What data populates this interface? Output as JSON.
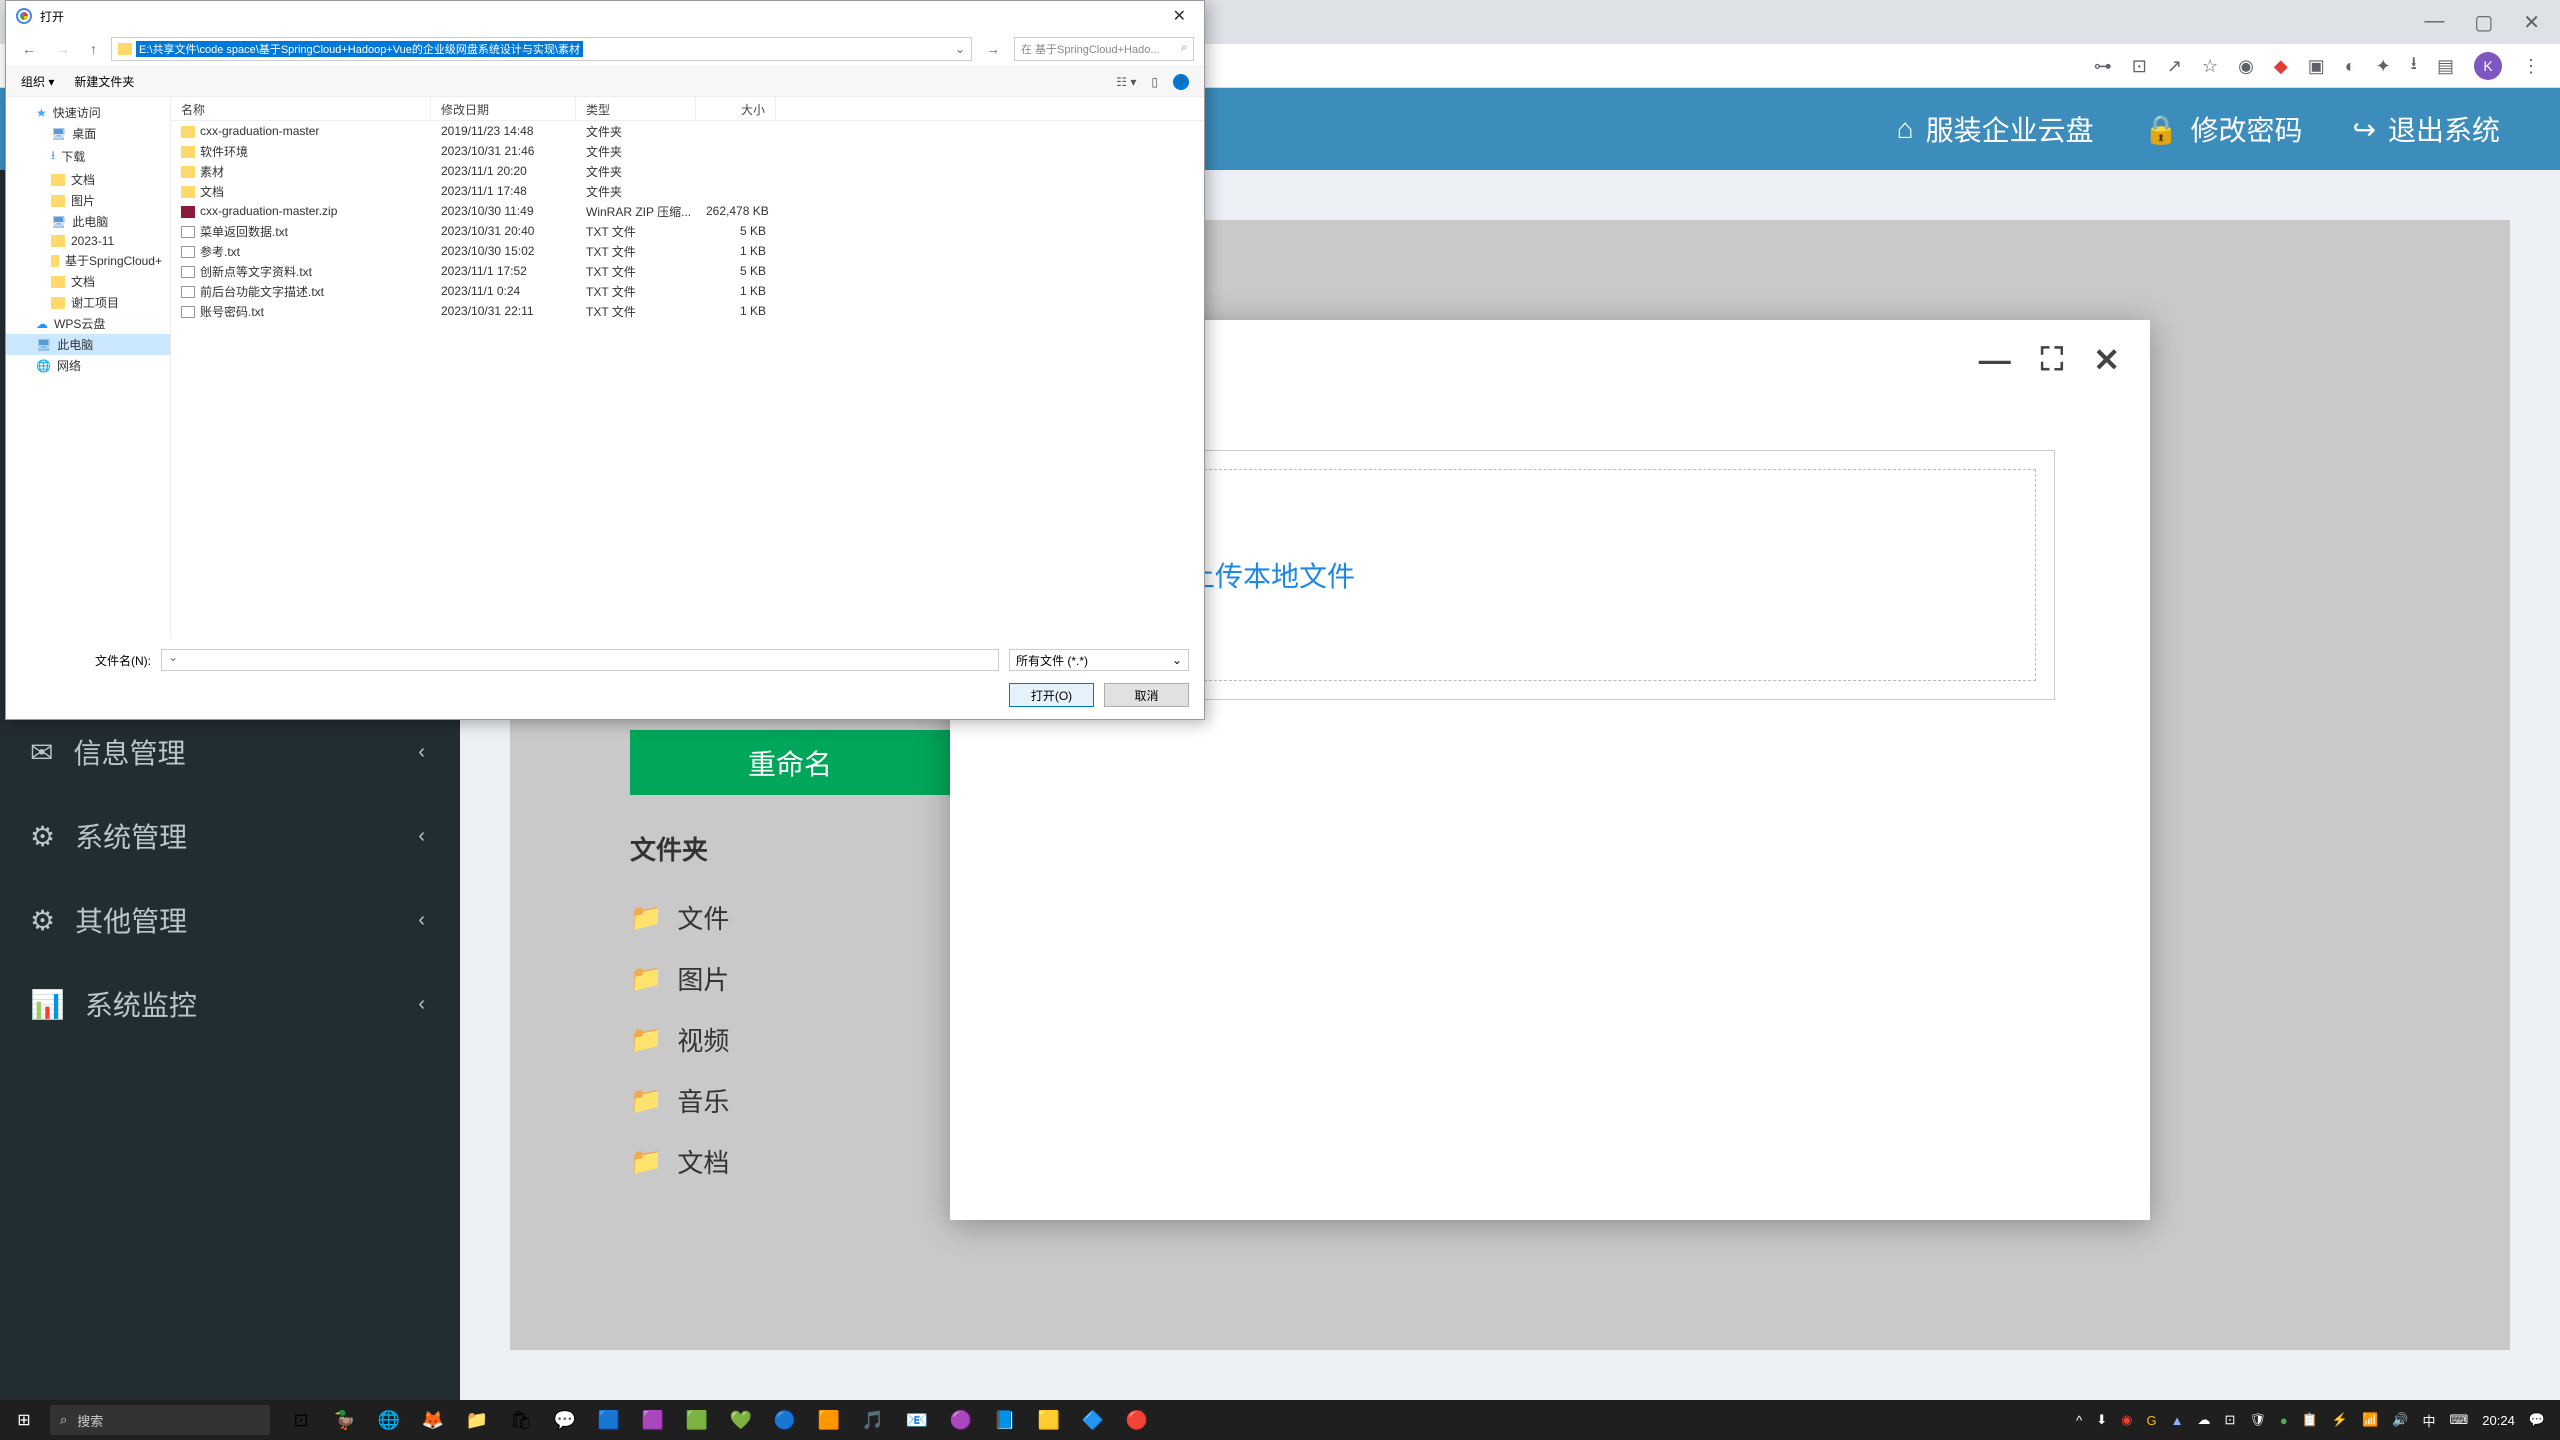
{
  "browser": {
    "avatar_letter": "K"
  },
  "header": {
    "item1": "服装企业云盘",
    "item2": "修改密码",
    "item3": "退出系统"
  },
  "sidebar": {
    "items": [
      {
        "label": "信息管理"
      },
      {
        "label": "系统管理"
      },
      {
        "label": "其他管理"
      },
      {
        "label": "系统监控"
      }
    ]
  },
  "content": {
    "rename_btn": "重命名",
    "folder_title": "文件夹",
    "folders": [
      "文件",
      "图片",
      "视频",
      "音乐",
      "文档"
    ]
  },
  "upload_modal": {
    "upload_text": "点击上传本地文件"
  },
  "file_dialog": {
    "title": "打开",
    "path": "E:\\共享文件\\code space\\基于SpringCloud+Hadoop+Vue的企业级网盘系统设计与实现\\素材",
    "search_placeholder": "在 基于SpringCloud+Hado...",
    "toolbar_organize": "组织",
    "toolbar_new": "新建文件夹",
    "columns": {
      "name": "名称",
      "date": "修改日期",
      "type": "类型",
      "size": "大小"
    },
    "tree": [
      {
        "label": "快速访问",
        "icon": "star",
        "level": 1
      },
      {
        "label": "桌面",
        "icon": "pc",
        "level": 2
      },
      {
        "label": "下载",
        "icon": "down",
        "level": 2
      },
      {
        "label": "文档",
        "icon": "folder",
        "level": 2
      },
      {
        "label": "图片",
        "icon": "folder",
        "level": 2
      },
      {
        "label": "此电脑",
        "icon": "pc",
        "level": 2
      },
      {
        "label": "2023-11",
        "icon": "folder",
        "level": 2
      },
      {
        "label": "基于SpringCloud+",
        "icon": "folder",
        "level": 2
      },
      {
        "label": "文档",
        "icon": "folder",
        "level": 2
      },
      {
        "label": "谢工项目",
        "icon": "folder",
        "level": 2
      },
      {
        "label": "WPS云盘",
        "icon": "cloud",
        "level": 1
      },
      {
        "label": "此电脑",
        "icon": "pc",
        "level": 1,
        "selected": true
      },
      {
        "label": "网络",
        "icon": "net",
        "level": 1
      }
    ],
    "files": [
      {
        "name": "cxx-graduation-master",
        "date": "2019/11/23 14:48",
        "type": "文件夹",
        "size": "",
        "icon": "folder"
      },
      {
        "name": "软件环境",
        "date": "2023/10/31 21:46",
        "type": "文件夹",
        "size": "",
        "icon": "folder"
      },
      {
        "name": "素材",
        "date": "2023/11/1 20:20",
        "type": "文件夹",
        "size": "",
        "icon": "folder"
      },
      {
        "name": "文档",
        "date": "2023/11/1 17:48",
        "type": "文件夹",
        "size": "",
        "icon": "folder"
      },
      {
        "name": "cxx-graduation-master.zip",
        "date": "2023/10/30 11:49",
        "type": "WinRAR ZIP 压缩...",
        "size": "262,478 KB",
        "icon": "zip"
      },
      {
        "name": "菜单返回数据.txt",
        "date": "2023/10/31 20:40",
        "type": "TXT 文件",
        "size": "5 KB",
        "icon": "txt"
      },
      {
        "name": "参考.txt",
        "date": "2023/10/30 15:02",
        "type": "TXT 文件",
        "size": "1 KB",
        "icon": "txt"
      },
      {
        "name": "创新点等文字资料.txt",
        "date": "2023/11/1 17:52",
        "type": "TXT 文件",
        "size": "5 KB",
        "icon": "txt"
      },
      {
        "name": "前后台功能文字描述.txt",
        "date": "2023/11/1 0:24",
        "type": "TXT 文件",
        "size": "1 KB",
        "icon": "txt"
      },
      {
        "name": "账号密码.txt",
        "date": "2023/10/31 22:11",
        "type": "TXT 文件",
        "size": "1 KB",
        "icon": "txt"
      }
    ],
    "filename_label": "文件名(N):",
    "filter": "所有文件 (*.*)",
    "open_btn": "打开(O)",
    "cancel_btn": "取消"
  },
  "taskbar": {
    "search": "搜索",
    "time": "20:24",
    "ime": "中"
  }
}
